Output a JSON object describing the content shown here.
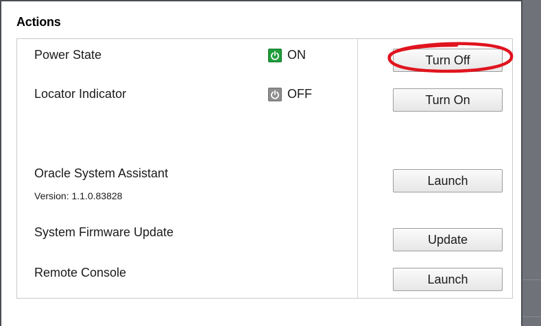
{
  "panel": {
    "title": "Actions"
  },
  "rows": {
    "power_state": {
      "label": "Power State",
      "status": "ON",
      "status_icon": "power-icon",
      "status_color": "#1f9d3a",
      "button_label": "Turn Off"
    },
    "locator_indicator": {
      "label": "Locator Indicator",
      "status": "OFF",
      "status_icon": "power-icon",
      "status_color": "#8e8e8e",
      "button_label": "Turn On"
    },
    "oracle_system_assistant": {
      "label": "Oracle System Assistant",
      "version": "Version: 1.1.0.83828",
      "button_label": "Launch"
    },
    "system_firmware_update": {
      "label": "System Firmware Update",
      "button_label": "Update"
    },
    "remote_console": {
      "label": "Remote Console",
      "button_label": "Launch"
    }
  },
  "annotation": {
    "shape": "ellipse",
    "color": "#e0141e",
    "target": "turn-off-button"
  }
}
